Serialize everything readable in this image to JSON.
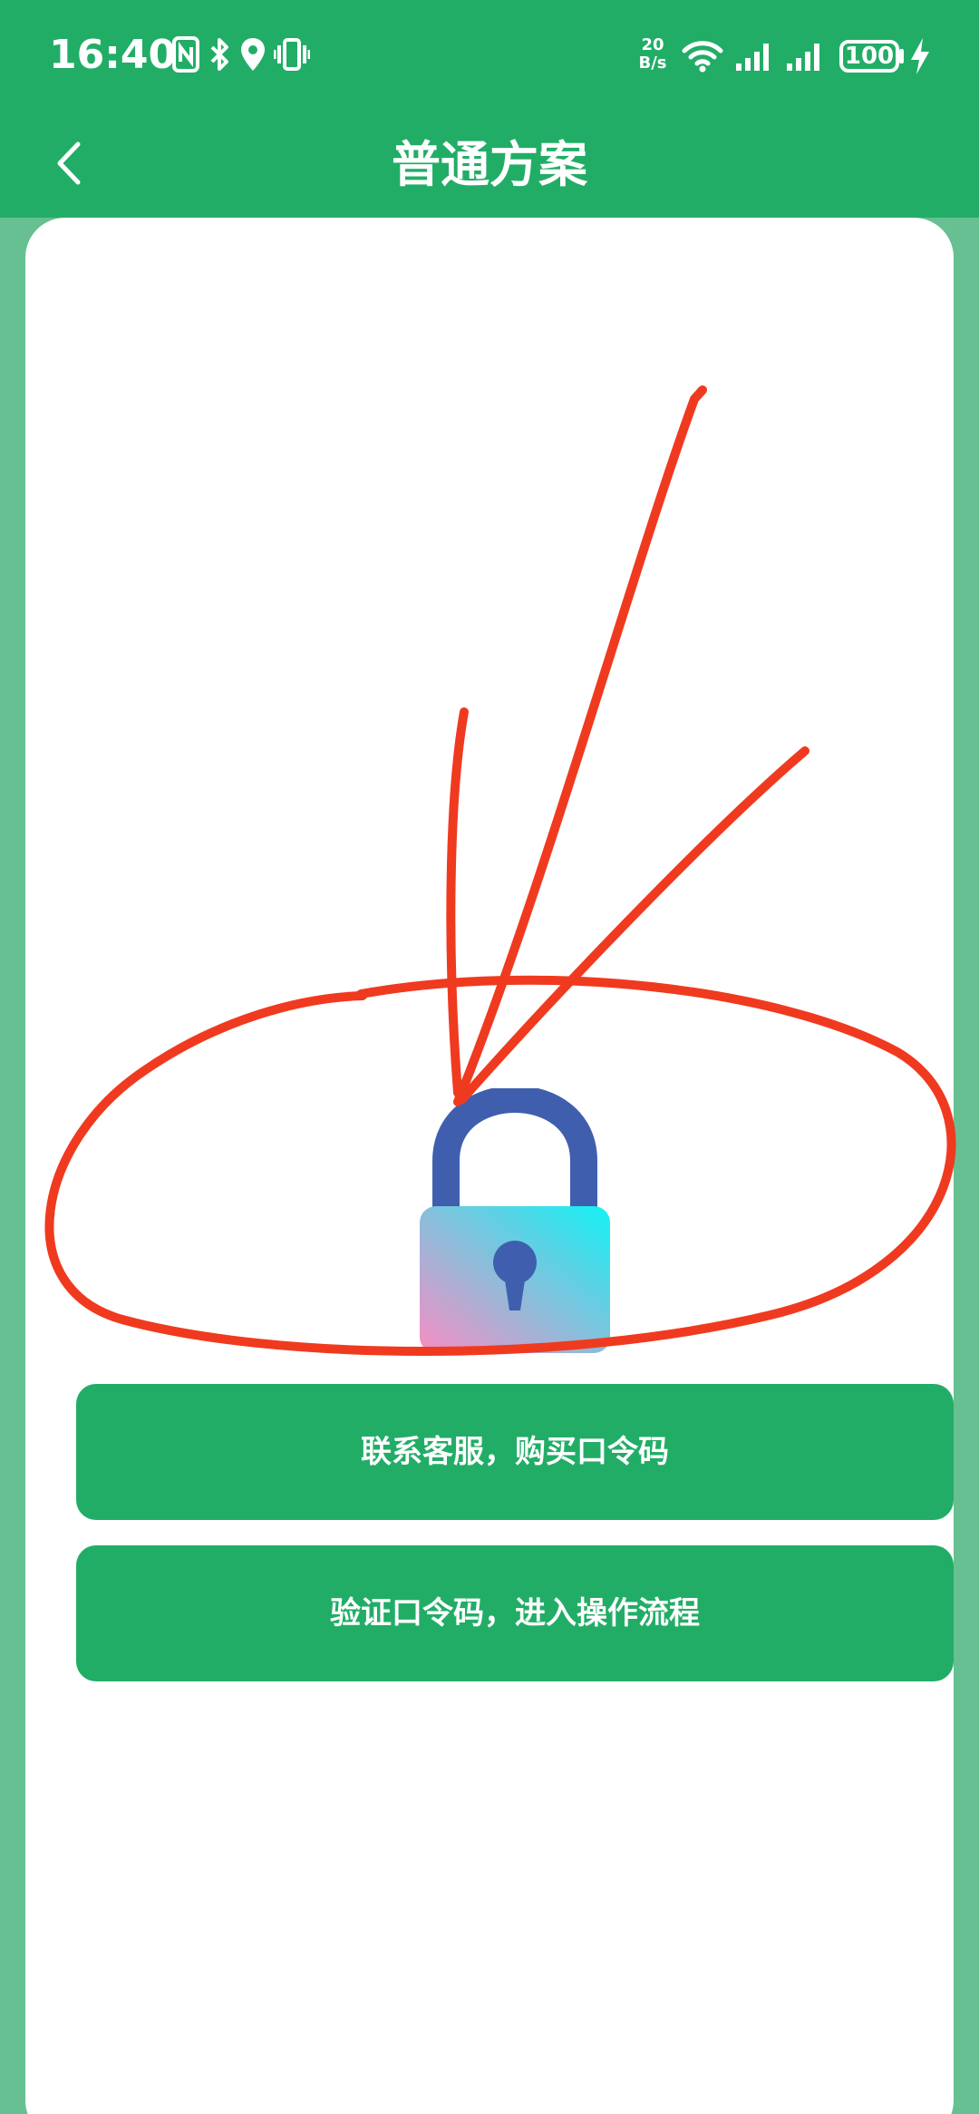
{
  "status_bar": {
    "time": "16:40",
    "network_speed_value": "20",
    "network_speed_unit": "B/s",
    "battery": "100",
    "icons": [
      "nfc-icon",
      "bluetooth-icon",
      "location-icon",
      "vibrate-icon",
      "wifi-icon",
      "signal-icon",
      "signal-icon",
      "battery-icon",
      "charging-icon"
    ]
  },
  "header": {
    "title": "普通方案",
    "back_icon": "chevron-left-icon"
  },
  "main": {
    "lock_icon": "lock-icon",
    "contact_button_label": "联系客服，购买口令码",
    "verify_button_label": "验证口令码，进入操作流程"
  },
  "colors": {
    "primary_green": "#22ad67",
    "background_green": "#67c091",
    "card_white": "#ffffff",
    "annotation_red": "#f03a1f",
    "lock_shackle": "#3f5fae",
    "lock_gradient_cyan": "#13f2f5",
    "lock_gradient_pink": "#f88dc2"
  }
}
